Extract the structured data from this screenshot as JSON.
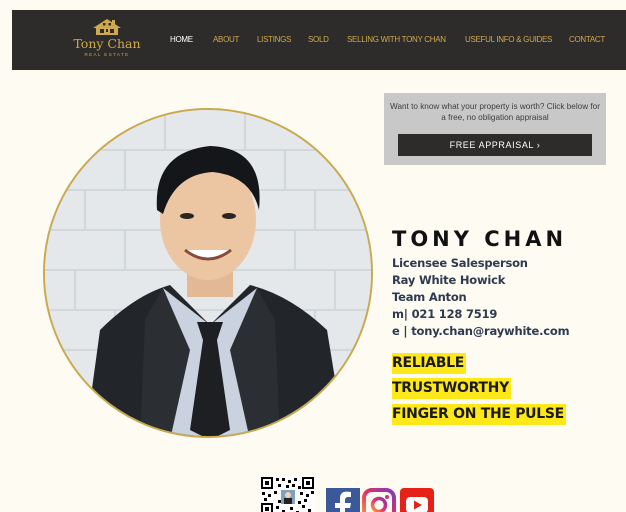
{
  "brand": {
    "name": "Tony Chan",
    "subtitle": "REAL ESTATE",
    "color": "#cfa94d"
  },
  "nav": {
    "items": [
      {
        "label": "HOME",
        "active": true
      },
      {
        "label": "ABOUT",
        "active": false
      },
      {
        "label": "LISTINGS",
        "active": false
      },
      {
        "label": "SOLD",
        "active": false
      },
      {
        "label": "SELLING WITH TONY CHAN",
        "active": false
      },
      {
        "label": "USEFUL INFO & GUIDES",
        "active": false
      },
      {
        "label": "CONTACT",
        "active": false
      }
    ]
  },
  "appraisal": {
    "text": "Want to know what your property is worth? Click below for a free, no obligation appraisal",
    "button_label": "FREE APPRAISAL ›"
  },
  "agent": {
    "name": "TONY CHAN",
    "title": "Licensee Salesperson",
    "office": "Ray White Howick",
    "team": "Team Anton",
    "mobile": "m| 021 128 7519",
    "email": "e | tony.chan@raywhite.com"
  },
  "taglines": [
    "RELIABLE",
    "TRUSTWORTHY",
    "FINGER ON THE PULSE"
  ],
  "social": {
    "facebook_color": "#3b5998",
    "youtube_color": "#e62117",
    "accent_yellow": "#ffe81a"
  },
  "icons": [
    "house-logo-icon",
    "qr-code-icon",
    "facebook-icon",
    "instagram-icon",
    "youtube-icon"
  ]
}
